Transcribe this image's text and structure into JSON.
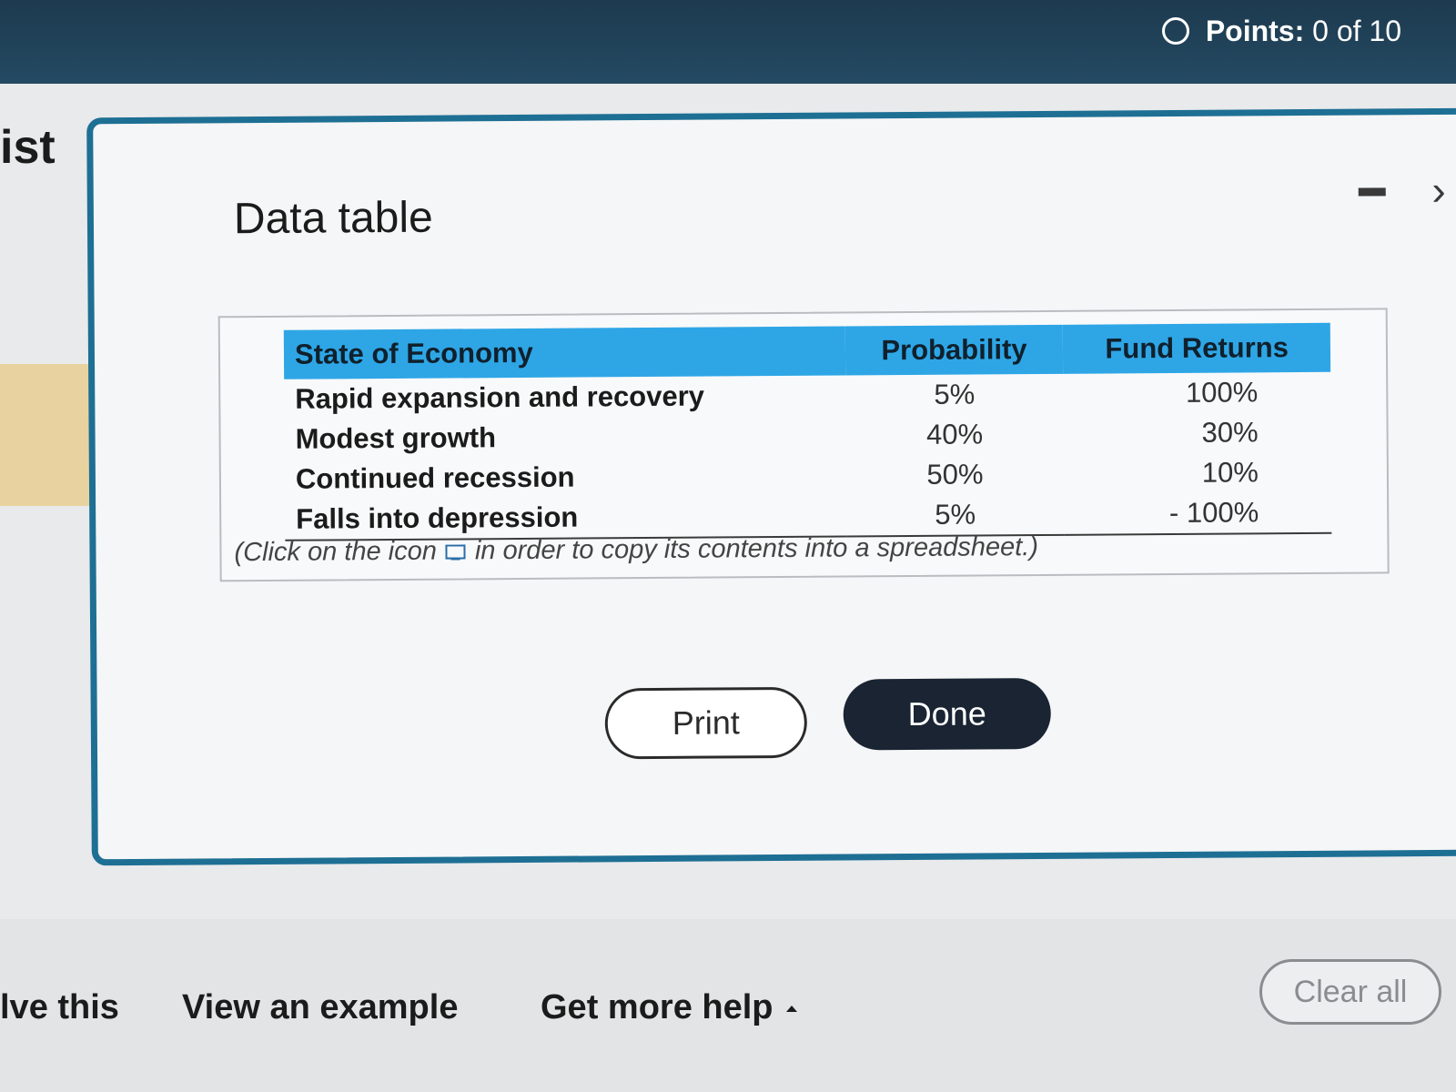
{
  "header": {
    "points_label": "Points:",
    "points_value": "0 of 10"
  },
  "background": {
    "title_fragment": "ist"
  },
  "modal": {
    "title": "Data table",
    "table": {
      "columns": [
        "State of Economy",
        "Probability",
        "Fund Returns"
      ],
      "rows": [
        [
          "Rapid expansion and recovery",
          "5%",
          "100%"
        ],
        [
          "Modest growth",
          "40%",
          "30%"
        ],
        [
          "Continued recession",
          "50%",
          "10%"
        ],
        [
          "Falls into depression",
          "5%",
          "- 100%"
        ]
      ]
    },
    "copy_note_before": "(Click on the icon",
    "copy_note_after": "in order to copy its contents into a spreadsheet.)",
    "print_label": "Print",
    "done_label": "Done"
  },
  "footer": {
    "solve_fragment": "lve this",
    "view_example": "View an example",
    "get_more_help": "Get more help",
    "clear_all": "Clear all"
  },
  "colors": {
    "header_bg": "#1d3a4f",
    "modal_border": "#1e6f94",
    "table_header_bg": "#2ea6e6",
    "done_bg": "#1a2433"
  }
}
